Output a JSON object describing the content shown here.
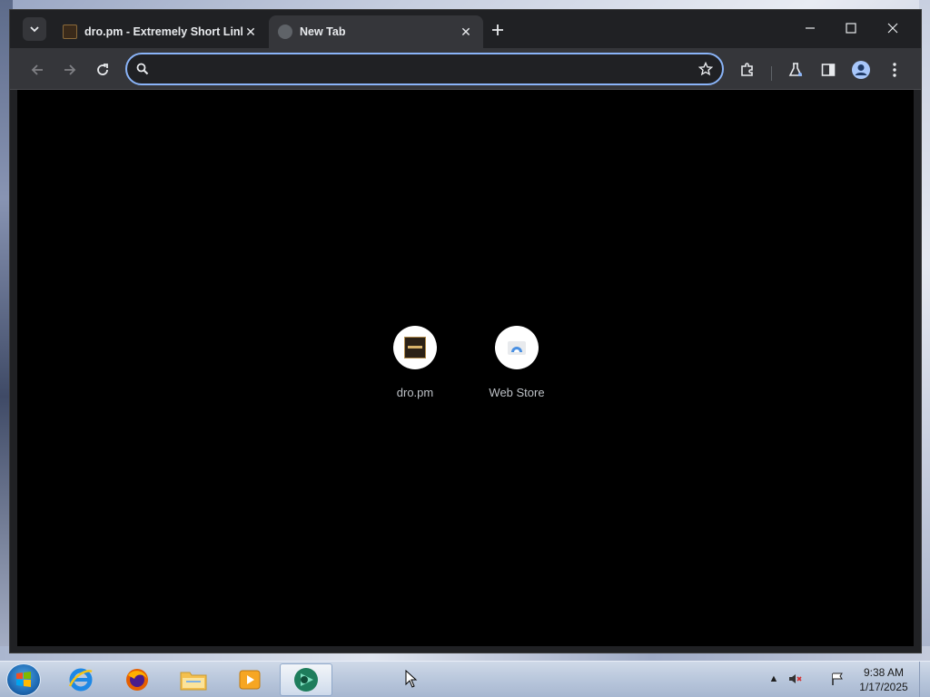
{
  "browser": {
    "tabs": [
      {
        "title": "dro.pm - Extremely Short Links",
        "active": false
      },
      {
        "title": "New Tab",
        "active": true
      }
    ],
    "omnibox": {
      "value": "",
      "placeholder": ""
    }
  },
  "new_tab_page": {
    "shortcuts": [
      {
        "label": "dro.pm",
        "icon": "dro-favicon"
      },
      {
        "label": "Web Store",
        "icon": "web-store-icon"
      }
    ]
  },
  "taskbar": {
    "pinned": [
      "internet-explorer-icon",
      "firefox-icon",
      "file-explorer-icon",
      "media-player-icon",
      "chrome-icon"
    ],
    "active_app": "chrome-icon",
    "clock": {
      "time": "9:38 AM",
      "date": "1/17/2025"
    }
  },
  "colors": {
    "accent": "#8ab4f8",
    "tabstrip": "#202124",
    "toolbar": "#35363a",
    "content": "#000000"
  }
}
